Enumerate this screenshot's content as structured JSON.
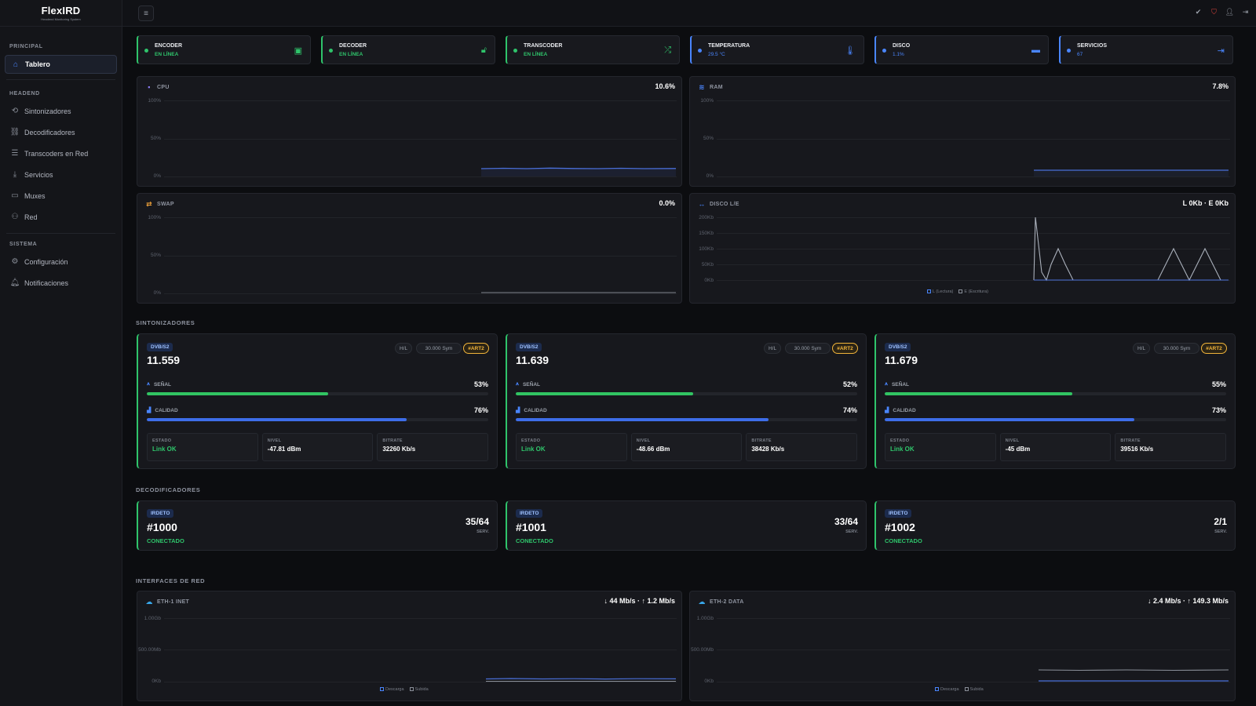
{
  "app": {
    "title": "FlexIRD",
    "subtitle": "Headend Monitoring System"
  },
  "sidebar": {
    "sections": [
      {
        "title": "PRINCIPAL",
        "items": [
          {
            "label": "Tablero",
            "icon": "home-icon",
            "active": true
          }
        ]
      },
      {
        "title": "HEADEND",
        "items": [
          {
            "label": "Sintonizadores",
            "icon": "satellite-icon"
          },
          {
            "label": "Decodificadores",
            "icon": "link-icon"
          },
          {
            "label": "Transcoders en Red",
            "icon": "server-icon"
          },
          {
            "label": "Servicios",
            "icon": "download-icon"
          },
          {
            "label": "Muxes",
            "icon": "monitor-icon"
          },
          {
            "label": "Red",
            "icon": "network-icon"
          }
        ]
      },
      {
        "title": "SISTEMA",
        "items": [
          {
            "label": "Configuración",
            "icon": "gear-icon"
          },
          {
            "label": "Notificaciones",
            "icon": "bell-icon"
          }
        ]
      }
    ]
  },
  "topbar": {
    "menu_icon": "hamburger-icon",
    "icons": [
      "check-circle-icon",
      "shield-icon",
      "user-icon",
      "logout-icon"
    ]
  },
  "status_cards": [
    {
      "label": "ENCODER",
      "value": "EN LÍNEA",
      "icon": "film-icon",
      "color": "#2fc46b"
    },
    {
      "label": "DECODER",
      "value": "EN LÍNEA",
      "icon": "unlock-icon",
      "color": "#2fc46b"
    },
    {
      "label": "TRANSCODER",
      "value": "EN LÍNEA",
      "icon": "shuffle-icon",
      "color": "#2fc46b"
    },
    {
      "label": "TEMPERATURA",
      "value": "29.5 °C",
      "icon": "thermometer-icon",
      "color": "#4a86ff"
    },
    {
      "label": "DISCO",
      "value": "1.1%",
      "icon": "disk-icon",
      "color": "#4a86ff"
    },
    {
      "label": "SERVICIOS",
      "value": "67",
      "icon": "sign-in-icon",
      "color": "#4a86ff"
    }
  ],
  "resources": {
    "cpu": {
      "label": "CPU",
      "value": "10.6%",
      "axis": [
        "100%",
        "50%",
        "0%"
      ]
    },
    "ram": {
      "label": "RAM",
      "value": "7.8%",
      "axis": [
        "100%",
        "50%",
        "0%"
      ]
    },
    "swap": {
      "label": "SWAP",
      "value": "0.0%",
      "axis": [
        "100%",
        "50%",
        "0%"
      ]
    },
    "disk_io": {
      "label": "DISCO L/E",
      "value": "L 0Kb · E 0Kb",
      "axis": [
        "200Kb",
        "150Kb",
        "100Kb",
        "50Kb",
        "0Kb"
      ],
      "legend": [
        "L (Lectura)",
        "E (Escritura)"
      ]
    }
  },
  "sections": {
    "tuners": "SINTONIZADORES",
    "decoders": "DECODIFICADORES",
    "network": "INTERFACES DE RED"
  },
  "tuner_labels": {
    "signal": "SEÑAL",
    "quality": "CALIDAD",
    "status": "ESTADO",
    "level": "NIVEL",
    "bitrate": "BITRATE"
  },
  "tuners": [
    {
      "type": "DVB/S2",
      "freq": "11.559",
      "pol": "H/L",
      "sym": "30.000 Sym",
      "tag": "#ART2",
      "signal": "53%",
      "signal_pct": 53,
      "quality": "76%",
      "quality_pct": 76,
      "status": "Link OK",
      "level": "-47.81 dBm",
      "bitrate": "32260 Kb/s"
    },
    {
      "type": "DVB/S2",
      "freq": "11.639",
      "pol": "H/L",
      "sym": "30.000 Sym",
      "tag": "#ART2",
      "signal": "52%",
      "signal_pct": 52,
      "quality": "74%",
      "quality_pct": 74,
      "status": "Link OK",
      "level": "-48.66 dBm",
      "bitrate": "38428 Kb/s"
    },
    {
      "type": "DVB/S2",
      "freq": "11.679",
      "pol": "H/L",
      "sym": "30.000 Sym",
      "tag": "#ART2",
      "signal": "55%",
      "signal_pct": 55,
      "quality": "73%",
      "quality_pct": 73,
      "status": "Link OK",
      "level": "-45 dBm",
      "bitrate": "39516 Kb/s"
    }
  ],
  "decoders": [
    {
      "type": "IRDETO",
      "id": "#1000",
      "status": "CONECTADO",
      "count": "35/64",
      "unit": "SERV."
    },
    {
      "type": "IRDETO",
      "id": "#1001",
      "status": "CONECTADO",
      "count": "33/64",
      "unit": "SERV."
    },
    {
      "type": "IRDETO",
      "id": "#1002",
      "status": "CONECTADO",
      "count": "2/1",
      "unit": "SERV."
    }
  ],
  "network": [
    {
      "label": "ETH-1 INET",
      "value": "↓ 44 Mb/s · ↑ 1.2 Mb/s",
      "axis": [
        "1.00Gb",
        "500.00Mb",
        "0Kb"
      ],
      "legend": [
        "Descarga",
        "Subida"
      ]
    },
    {
      "label": "ETH-2 DATA",
      "value": "↓ 2.4 Mb/s · ↑ 149.3 Mb/s",
      "axis": [
        "1.00Gb",
        "500.00Mb",
        "0Kb"
      ],
      "legend": [
        "Descarga",
        "Subida"
      ]
    }
  ]
}
